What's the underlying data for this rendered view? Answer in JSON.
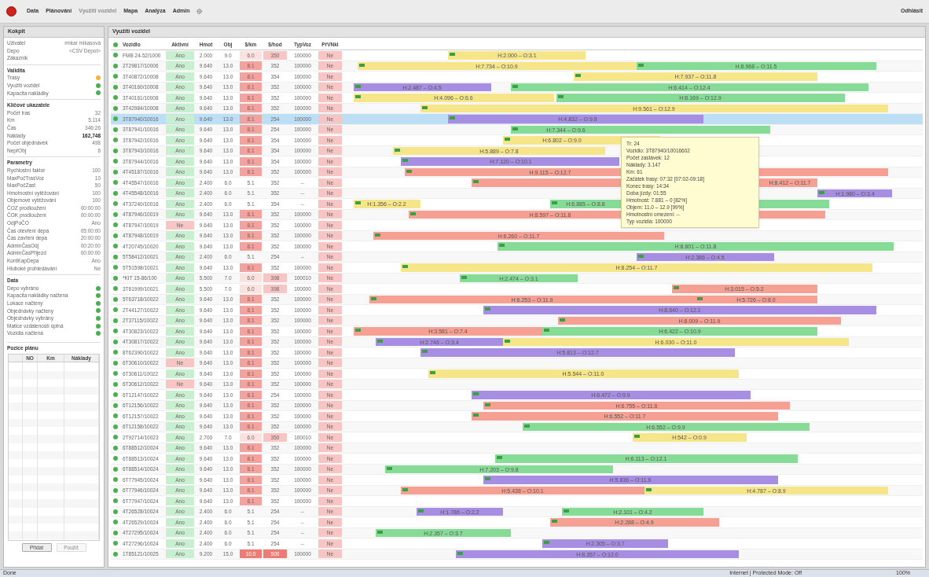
{
  "menu": {
    "items": [
      {
        "label": "Data",
        "disabled": false
      },
      {
        "label": "Plánování",
        "disabled": false
      },
      {
        "label": "Využití vozidel",
        "disabled": true
      },
      {
        "label": "Mapa",
        "disabled": false
      },
      {
        "label": "Analýza",
        "disabled": false
      },
      {
        "label": "Admin",
        "disabled": false
      }
    ],
    "logout": "Odhlásit"
  },
  "sidebar": {
    "title": "Kokpit",
    "info": [
      {
        "label": "Uživatel",
        "value": "rmkar mikasová"
      },
      {
        "label": "Depo",
        "value": "<CSV Depot>"
      },
      {
        "label": "Zákazník"
      }
    ],
    "sections": [
      {
        "title": "Validita",
        "rows": [
          {
            "kind": "status",
            "label": "Trasy",
            "color": "#f2b632"
          },
          {
            "kind": "status",
            "label": "Využití vozidel",
            "color": "#4caf50"
          },
          {
            "kind": "status",
            "label": "Kapacita nakládky",
            "color": "#4caf50"
          }
        ]
      },
      {
        "title": "Klíčové ukazatele",
        "rows": [
          {
            "kind": "value",
            "label": "Počet tras",
            "value": "32"
          },
          {
            "kind": "value",
            "label": "Km",
            "value": "5.114"
          },
          {
            "kind": "value",
            "label": "Čas",
            "value": "346:26"
          },
          {
            "kind": "bold",
            "label": "Náklady",
            "value": "162,748"
          },
          {
            "kind": "value",
            "label": "Počet objednávek",
            "value": "498"
          },
          {
            "kind": "value",
            "label": "NepřObj",
            "value": "6"
          }
        ]
      },
      {
        "title": "Parametry",
        "rows": [
          {
            "kind": "value",
            "label": "Rychlostní faktor",
            "value": "100"
          },
          {
            "kind": "value",
            "label": "MaxPočTrasVoz",
            "value": "10"
          },
          {
            "kind": "value",
            "label": "MaxPočZast",
            "value": "50"
          },
          {
            "kind": "value",
            "label": "Hmotnostní vytěžování",
            "value": "100"
          },
          {
            "kind": "value",
            "label": "Objemové vytěžování",
            "value": "100"
          },
          {
            "kind": "value",
            "label": "ČOZ prodloužení",
            "value": "00:00:00"
          },
          {
            "kind": "value",
            "label": "ČOK prodloužení",
            "value": "00:00:00"
          },
          {
            "kind": "value",
            "label": "OdjPoČO",
            "value": "Ano"
          },
          {
            "kind": "value",
            "label": "Čas otevření depa",
            "value": "05:00:00"
          },
          {
            "kind": "value",
            "label": "Čas zavření depa",
            "value": "20:00:00"
          },
          {
            "kind": "value",
            "label": "AdminČasOdj",
            "value": "00:20:00"
          },
          {
            "kind": "value",
            "label": "AdminČasPřijezd",
            "value": "00:00:00"
          },
          {
            "kind": "value",
            "label": "KontKapDepa",
            "value": "Ano"
          },
          {
            "kind": "value",
            "label": "Hluboké prohledávání",
            "value": "Ne"
          }
        ]
      },
      {
        "title": "Data",
        "rows": [
          {
            "kind": "status",
            "label": "Depo vybráno",
            "color": "#4caf50"
          },
          {
            "kind": "status",
            "label": "Kapacita nakládky načtena",
            "color": "#4caf50"
          },
          {
            "kind": "status",
            "label": "Lokace načteny",
            "color": "#4caf50"
          },
          {
            "kind": "status",
            "label": "Objednávky načteny",
            "color": "#4caf50"
          },
          {
            "kind": "status",
            "label": "Objednávky vybrány",
            "color": "#4caf50"
          },
          {
            "kind": "status",
            "label": "Matice vzdáleností úplná",
            "color": "#4caf50"
          },
          {
            "kind": "status",
            "label": "Vozidla načtena",
            "color": "#4caf50"
          }
        ]
      }
    ],
    "plan": {
      "title": "Pozice plánu",
      "columns": [
        "NO",
        "Km",
        "Náklady"
      ],
      "buttons": [
        {
          "label": "Přidat",
          "disabled": false
        },
        {
          "label": "Použít",
          "disabled": true
        }
      ]
    }
  },
  "panel_title": "Využití vozidel",
  "table": {
    "columns": [
      "Vozidlo",
      "Aktivní",
      "Hmot",
      "Obj",
      "$/km",
      "$/hod",
      "TypVoz",
      "PřVNkl"
    ],
    "rows": [
      {
        "selected": false,
        "cells": [
          {
            "text": "FMB 24-52/1000"
          },
          {
            "text": "Ano",
            "kind": "good"
          },
          {
            "text": "2.000"
          },
          {
            "text": "9.0"
          },
          {
            "text": "6.0",
            "kind": "light"
          },
          {
            "text": "350",
            "kind": "bad"
          },
          {
            "text": "100000"
          },
          {
            "text": "Ne",
            "kind": "bad"
          }
        ],
        "bars": [
          {
            "color": "#f7e58a",
            "label": "H:2.000 – O:3.1"
          }
        ]
      },
      {
        "selected": false,
        "cells": [
          {
            "text": "2T29817/10006"
          },
          {
            "text": "Ano",
            "kind": "good"
          },
          {
            "text": "9.640"
          },
          {
            "text": "13.0"
          },
          {
            "text": "8.1",
            "kind": "hot"
          },
          {
            "text": "352"
          },
          {
            "text": "100000"
          },
          {
            "text": "Ne",
            "kind": "bad"
          }
        ],
        "bars": [
          {
            "color": "#f7e58a",
            "label": "H:7.734 – O:10.9"
          },
          {
            "color": "#86dc96",
            "label": "H:8.968 – O:11.5"
          }
        ]
      },
      {
        "selected": false,
        "cells": [
          {
            "text": "3T40872/10008"
          },
          {
            "text": "Ano",
            "kind": "good"
          },
          {
            "text": "9.640"
          },
          {
            "text": "13.0"
          },
          {
            "text": "8.1",
            "kind": "hot"
          },
          {
            "text": "354"
          },
          {
            "text": "100000"
          },
          {
            "text": "Ne",
            "kind": "bad"
          }
        ],
        "bars": [
          {
            "color": "#f7e58a",
            "label": "H:7.937 – O:11.8"
          }
        ]
      },
      {
        "selected": false,
        "cells": [
          {
            "text": "3T40160/10008"
          },
          {
            "text": "Ano",
            "kind": "good"
          },
          {
            "text": "9.640"
          },
          {
            "text": "13.0"
          },
          {
            "text": "8.1",
            "kind": "hot"
          },
          {
            "text": "352"
          },
          {
            "text": "100000"
          },
          {
            "text": "Ne",
            "kind": "bad"
          }
        ],
        "bars": [
          {
            "color": "#a88ee3",
            "label": "H:2.487 – O:4.5"
          },
          {
            "color": "#86dc96",
            "label": "H:6.414 – O:12.4"
          }
        ]
      },
      {
        "selected": false,
        "cells": [
          {
            "text": "3T40161/10008"
          },
          {
            "text": "Ano",
            "kind": "good"
          },
          {
            "text": "9.640"
          },
          {
            "text": "13.0"
          },
          {
            "text": "8.1",
            "kind": "hot"
          },
          {
            "text": "352"
          },
          {
            "text": "100000"
          },
          {
            "text": "Ne",
            "kind": "bad"
          }
        ],
        "bars": [
          {
            "color": "#f7e58a",
            "label": "H:4.096 – O:6.6"
          },
          {
            "color": "#86dc96",
            "label": "H:8.169 – O:12.9"
          }
        ]
      },
      {
        "selected": false,
        "cells": [
          {
            "text": "3T42984/10008"
          },
          {
            "text": "Ano",
            "kind": "good"
          },
          {
            "text": "9.640"
          },
          {
            "text": "13.0"
          },
          {
            "text": "8.1",
            "kind": "hot"
          },
          {
            "text": "352"
          },
          {
            "text": "100000"
          },
          {
            "text": "Ne",
            "kind": "bad"
          }
        ],
        "bars": [
          {
            "color": "#f7e58a",
            "label": "H:9.561 – O:12.9"
          }
        ]
      },
      {
        "selected": true,
        "cells": [
          {
            "text": "3T87940/10016"
          },
          {
            "text": "Ano",
            "kind": "good"
          },
          {
            "text": "9.640"
          },
          {
            "text": "13.0"
          },
          {
            "text": "8.1",
            "kind": "hot"
          },
          {
            "text": "254"
          },
          {
            "text": "100000"
          },
          {
            "text": "Ne",
            "kind": "bad"
          }
        ],
        "bars": [
          {
            "color": "#a88ee3",
            "label": "H:4.832 – O:9.8"
          }
        ]
      },
      {
        "selected": false,
        "cells": [
          {
            "text": "3T87941/10016"
          },
          {
            "text": "Ano",
            "kind": "good"
          },
          {
            "text": "9.640"
          },
          {
            "text": "13.0"
          },
          {
            "text": "8.1",
            "kind": "hot"
          },
          {
            "text": "254"
          },
          {
            "text": "100000"
          },
          {
            "text": "Ne",
            "kind": "bad"
          }
        ],
        "bars": [
          {
            "color": "#86dc96",
            "label": "H:7.344 – O:9.6"
          }
        ]
      },
      {
        "selected": false,
        "cells": [
          {
            "text": "3T87942/10016"
          },
          {
            "text": "Ano",
            "kind": "good"
          },
          {
            "text": "9.640"
          },
          {
            "text": "13.0"
          },
          {
            "text": "8.1",
            "kind": "hot"
          },
          {
            "text": "354"
          },
          {
            "text": "100000"
          },
          {
            "text": "Ne",
            "kind": "bad"
          }
        ],
        "bars": [
          {
            "color": "#f7e58a",
            "label": "H:6.802 – O:9.0"
          }
        ]
      },
      {
        "selected": false,
        "cells": [
          {
            "text": "3T87943/10016"
          },
          {
            "text": "Ano",
            "kind": "good"
          },
          {
            "text": "9.640"
          },
          {
            "text": "13.0"
          },
          {
            "text": "8.1",
            "kind": "hot"
          },
          {
            "text": "354"
          },
          {
            "text": "100000"
          },
          {
            "text": "Ne",
            "kind": "bad"
          }
        ],
        "bars": [
          {
            "color": "#f7e58a",
            "label": "H:5.889 – O:7.8"
          }
        ]
      },
      {
        "selected": false,
        "cells": [
          {
            "text": "3T87944/10016"
          },
          {
            "text": "Ano",
            "kind": "good"
          },
          {
            "text": "9.640"
          },
          {
            "text": "13.0"
          },
          {
            "text": "8.1",
            "kind": "hot"
          },
          {
            "text": "354"
          },
          {
            "text": "100000"
          },
          {
            "text": "Ne",
            "kind": "bad"
          }
        ],
        "bars": [
          {
            "color": "#a88ee3",
            "label": "H:7.120 – O:10.1"
          }
        ]
      },
      {
        "selected": false,
        "cells": [
          {
            "text": "4T45187/10016"
          },
          {
            "text": "Ano",
            "kind": "good"
          },
          {
            "text": "9.640"
          },
          {
            "text": "13.0"
          },
          {
            "text": "8.1",
            "kind": "hot"
          },
          {
            "text": "352"
          },
          {
            "text": "100000"
          },
          {
            "text": "Ne",
            "kind": "bad"
          }
        ],
        "bars": [
          {
            "color": "#f5a093",
            "label": "H:9.115 – O:12.7"
          }
        ]
      },
      {
        "selected": false,
        "cells": [
          {
            "text": "4T45547/10016"
          },
          {
            "text": "Ano",
            "kind": "good"
          },
          {
            "text": "2.400"
          },
          {
            "text": "6.0"
          },
          {
            "text": "5.1"
          },
          {
            "text": "352"
          },
          {
            "text": "--"
          },
          {
            "text": "Ne",
            "kind": "bad"
          }
        ],
        "bars": [
          {
            "color": "#f5a093",
            "label": "H:8.412 – O:11.7"
          }
        ]
      },
      {
        "selected": false,
        "cells": [
          {
            "text": "4T45548/10016"
          },
          {
            "text": "Ano",
            "kind": "good"
          },
          {
            "text": "2.400"
          },
          {
            "text": "6.0"
          },
          {
            "text": "5.1"
          },
          {
            "text": "352"
          },
          {
            "text": "--"
          },
          {
            "text": "Ne",
            "kind": "bad"
          }
        ],
        "bars": [
          {
            "color": "#a88ee3",
            "label": "H:1.980 – O:3.4"
          }
        ]
      },
      {
        "selected": false,
        "cells": [
          {
            "text": "4T37240/10016"
          },
          {
            "text": "Ano",
            "kind": "good"
          },
          {
            "text": "2.400"
          },
          {
            "text": "6.0"
          },
          {
            "text": "5.1"
          },
          {
            "text": "354"
          },
          {
            "text": "--"
          },
          {
            "text": "Ne",
            "kind": "bad"
          }
        ],
        "bars": [
          {
            "color": "#f7e58a",
            "label": "H:1.356 – O:2.2"
          },
          {
            "color": "#86dc96",
            "label": "H:6.885 – O:8.8"
          }
        ]
      },
      {
        "selected": false,
        "cells": [
          {
            "text": "4T87946/10019"
          },
          {
            "text": "Ano",
            "kind": "good"
          },
          {
            "text": "9.640"
          },
          {
            "text": "13.0"
          },
          {
            "text": "8.1",
            "kind": "hot"
          },
          {
            "text": "352"
          },
          {
            "text": "100000"
          },
          {
            "text": "Ne",
            "kind": "bad"
          }
        ],
        "bars": [
          {
            "color": "#f5a093",
            "label": "H:8.597 – O:11.8"
          }
        ]
      },
      {
        "selected": false,
        "cells": [
          {
            "text": "4T87947/10019"
          },
          {
            "text": "Ne",
            "kind": "bad"
          },
          {
            "text": "9.640"
          },
          {
            "text": "13.0"
          },
          {
            "text": "8.1",
            "kind": "hot"
          },
          {
            "text": "352"
          },
          {
            "text": "100000"
          },
          {
            "text": "Ne",
            "kind": "bad"
          }
        ],
        "bars": []
      },
      {
        "selected": false,
        "cells": [
          {
            "text": "4T87948/10019"
          },
          {
            "text": "Ano",
            "kind": "good"
          },
          {
            "text": "9.640"
          },
          {
            "text": "13.0"
          },
          {
            "text": "8.1",
            "kind": "hot"
          },
          {
            "text": "352"
          },
          {
            "text": "100000"
          },
          {
            "text": "Ne",
            "kind": "bad"
          }
        ],
        "bars": [
          {
            "color": "#f5a093",
            "label": "H:6.260 – O:11.7"
          }
        ]
      },
      {
        "selected": false,
        "cells": [
          {
            "text": "4T20745/10020"
          },
          {
            "text": "Ano",
            "kind": "good"
          },
          {
            "text": "9.640"
          },
          {
            "text": "13.0"
          },
          {
            "text": "8.1",
            "kind": "hot"
          },
          {
            "text": "352"
          },
          {
            "text": "100000"
          },
          {
            "text": "Ne",
            "kind": "bad"
          }
        ],
        "bars": [
          {
            "color": "#86dc96",
            "label": "H:8.601 – O:11.8"
          }
        ]
      },
      {
        "selected": false,
        "cells": [
          {
            "text": "5T58412/10021"
          },
          {
            "text": "Ano",
            "kind": "good"
          },
          {
            "text": "2.400"
          },
          {
            "text": "6.0"
          },
          {
            "text": "5.1"
          },
          {
            "text": "254"
          },
          {
            "text": "--"
          },
          {
            "text": "Ne",
            "kind": "bad"
          }
        ],
        "bars": [
          {
            "color": "#a88ee3",
            "label": "H:2.386 – O:4.5"
          }
        ]
      },
      {
        "selected": false,
        "cells": [
          {
            "text": "5T51598/10021"
          },
          {
            "text": "Ano",
            "kind": "good"
          },
          {
            "text": "9.640"
          },
          {
            "text": "13.0"
          },
          {
            "text": "8.1",
            "kind": "hot"
          },
          {
            "text": "352"
          },
          {
            "text": "100000"
          },
          {
            "text": "Ne",
            "kind": "bad"
          }
        ],
        "bars": [
          {
            "color": "#f7e58a",
            "label": "H:8.254 – O:11.7"
          }
        ]
      },
      {
        "selected": false,
        "cells": [
          {
            "text": "*KIT 15-86/100"
          },
          {
            "text": "Ano",
            "kind": "good"
          },
          {
            "text": "5.500"
          },
          {
            "text": "7.0"
          },
          {
            "text": "6.0",
            "kind": "light"
          },
          {
            "text": "398",
            "kind": "bad"
          },
          {
            "text": "100010"
          },
          {
            "text": "Ne",
            "kind": "bad"
          }
        ],
        "bars": [
          {
            "color": "#86dc96",
            "label": "H:2.474 – O:3.1"
          }
        ]
      },
      {
        "selected": false,
        "cells": [
          {
            "text": "3T61999/10021"
          },
          {
            "text": "Ano",
            "kind": "good"
          },
          {
            "text": "5.500"
          },
          {
            "text": "7.0"
          },
          {
            "text": "6.0",
            "kind": "light"
          },
          {
            "text": "398",
            "kind": "bad"
          },
          {
            "text": "100000"
          },
          {
            "text": "Ne",
            "kind": "bad"
          }
        ],
        "bars": [
          {
            "color": "#f5a093",
            "label": "H:3.015 – O:5.2"
          }
        ]
      },
      {
        "selected": false,
        "cells": [
          {
            "text": "5T63718/10022"
          },
          {
            "text": "Ano",
            "kind": "good"
          },
          {
            "text": "9.640"
          },
          {
            "text": "13.0"
          },
          {
            "text": "8.1",
            "kind": "hot"
          },
          {
            "text": "352"
          },
          {
            "text": "100000"
          },
          {
            "text": "Ne",
            "kind": "bad"
          }
        ],
        "bars": [
          {
            "color": "#f5a093",
            "label": "H:6.253 – O:11.9"
          },
          {
            "color": "#f5a093",
            "label": "H:5.726 – O:8.0"
          }
        ]
      },
      {
        "selected": false,
        "cells": [
          {
            "text": "2T44127/10022"
          },
          {
            "text": "Ano",
            "kind": "good"
          },
          {
            "text": "9.640"
          },
          {
            "text": "13.0"
          },
          {
            "text": "8.1",
            "kind": "hot"
          },
          {
            "text": "352"
          },
          {
            "text": "100000"
          },
          {
            "text": "Ne",
            "kind": "bad"
          }
        ],
        "bars": [
          {
            "color": "#a88ee3",
            "label": "H:8.640 – O:12.1"
          }
        ]
      },
      {
        "selected": false,
        "cells": [
          {
            "text": "2T37115/10022"
          },
          {
            "text": "Ano",
            "kind": "good"
          },
          {
            "text": "9.640"
          },
          {
            "text": "13.0"
          },
          {
            "text": "8.1",
            "kind": "hot"
          },
          {
            "text": "352"
          },
          {
            "text": "100000"
          },
          {
            "text": "Ne",
            "kind": "bad"
          }
        ],
        "bars": [
          {
            "color": "#f5a093",
            "label": "H:8.009 – O:11.9"
          }
        ]
      },
      {
        "selected": false,
        "cells": [
          {
            "text": "4T30823/10022"
          },
          {
            "text": "Ano",
            "kind": "good"
          },
          {
            "text": "9.640"
          },
          {
            "text": "13.0"
          },
          {
            "text": "8.1",
            "kind": "hot"
          },
          {
            "text": "352"
          },
          {
            "text": "100000"
          },
          {
            "text": "Ne",
            "kind": "bad"
          }
        ],
        "bars": [
          {
            "color": "#f5a093",
            "label": "H:3.581 – O:7.4"
          },
          {
            "color": "#86dc96",
            "label": "H:6.422 – O:10.9"
          }
        ]
      },
      {
        "selected": false,
        "cells": [
          {
            "text": "4T30817/10022"
          },
          {
            "text": "Ano",
            "kind": "good"
          },
          {
            "text": "9.640"
          },
          {
            "text": "13.0"
          },
          {
            "text": "8.1",
            "kind": "hot"
          },
          {
            "text": "352"
          },
          {
            "text": "100000"
          },
          {
            "text": "Ne",
            "kind": "bad"
          }
        ],
        "bars": [
          {
            "color": "#a88ee3",
            "label": "H:2.746 – O:3.4"
          },
          {
            "color": "#f7e58a",
            "label": "H:6.030 – O:11.0"
          }
        ]
      },
      {
        "selected": false,
        "cells": [
          {
            "text": "8T62390/10022"
          },
          {
            "text": "Ano",
            "kind": "good"
          },
          {
            "text": "9.640"
          },
          {
            "text": "13.0"
          },
          {
            "text": "8.1",
            "kind": "hot"
          },
          {
            "text": "352"
          },
          {
            "text": "100000"
          },
          {
            "text": "Ne",
            "kind": "bad"
          }
        ],
        "bars": [
          {
            "color": "#a88ee3",
            "label": "H:5.813 – O:12.7"
          }
        ]
      },
      {
        "selected": false,
        "cells": [
          {
            "text": "6T30610/10022"
          },
          {
            "text": "Ne",
            "kind": "bad"
          },
          {
            "text": "9.640"
          },
          {
            "text": "13.0"
          },
          {
            "text": "8.1",
            "kind": "hot"
          },
          {
            "text": "352"
          },
          {
            "text": "100000"
          },
          {
            "text": "Ne",
            "kind": "bad"
          }
        ],
        "bars": []
      },
      {
        "selected": false,
        "cells": [
          {
            "text": "6T30611/10022"
          },
          {
            "text": "Ano",
            "kind": "good"
          },
          {
            "text": "9.640"
          },
          {
            "text": "13.0"
          },
          {
            "text": "8.1",
            "kind": "hot"
          },
          {
            "text": "352"
          },
          {
            "text": "100000"
          },
          {
            "text": "Ne",
            "kind": "bad"
          }
        ],
        "bars": [
          {
            "color": "#f7e58a",
            "label": "H:5.544 – O:11.0"
          }
        ]
      },
      {
        "selected": false,
        "cells": [
          {
            "text": "6T30612/10022"
          },
          {
            "text": "Ne",
            "kind": "bad"
          },
          {
            "text": "9.640"
          },
          {
            "text": "13.0"
          },
          {
            "text": "8.1",
            "kind": "hot"
          },
          {
            "text": "352"
          },
          {
            "text": "100000"
          },
          {
            "text": "Ne",
            "kind": "bad"
          }
        ],
        "bars": []
      },
      {
        "selected": false,
        "cells": [
          {
            "text": "6T12147/10022"
          },
          {
            "text": "Ano",
            "kind": "good"
          },
          {
            "text": "9.640"
          },
          {
            "text": "13.0"
          },
          {
            "text": "8.1",
            "kind": "hot"
          },
          {
            "text": "254"
          },
          {
            "text": "100000"
          },
          {
            "text": "Ne",
            "kind": "bad"
          }
        ],
        "bars": [
          {
            "color": "#a88ee3",
            "label": "H:6.472 – O:9.9"
          }
        ]
      },
      {
        "selected": false,
        "cells": [
          {
            "text": "6T12156/10022"
          },
          {
            "text": "Ano",
            "kind": "good"
          },
          {
            "text": "9.640"
          },
          {
            "text": "13.0"
          },
          {
            "text": "8.1",
            "kind": "hot"
          },
          {
            "text": "352"
          },
          {
            "text": "100000"
          },
          {
            "text": "Ne",
            "kind": "bad"
          }
        ],
        "bars": [
          {
            "color": "#f5a093",
            "label": "H:6.755 – O:11.6"
          }
        ]
      },
      {
        "selected": false,
        "cells": [
          {
            "text": "6T12157/10022"
          },
          {
            "text": "Ano",
            "kind": "good"
          },
          {
            "text": "9.640"
          },
          {
            "text": "13.0"
          },
          {
            "text": "8.1",
            "kind": "hot"
          },
          {
            "text": "352"
          },
          {
            "text": "100000"
          },
          {
            "text": "Ne",
            "kind": "bad"
          }
        ],
        "bars": [
          {
            "color": "#f5a093",
            "label": "H:6.552 – O:11.7"
          }
        ]
      },
      {
        "selected": false,
        "cells": [
          {
            "text": "6T12158/10022"
          },
          {
            "text": "Ano",
            "kind": "good"
          },
          {
            "text": "9.640"
          },
          {
            "text": "13.0"
          },
          {
            "text": "8.1",
            "kind": "hot"
          },
          {
            "text": "352"
          },
          {
            "text": "100000"
          },
          {
            "text": "Ne",
            "kind": "bad"
          }
        ],
        "bars": [
          {
            "color": "#86dc96",
            "label": "H:6.552 – O:9.9"
          }
        ]
      },
      {
        "selected": false,
        "cells": [
          {
            "text": "2T92714/10023"
          },
          {
            "text": "Ano",
            "kind": "good"
          },
          {
            "text": "2.700"
          },
          {
            "text": "7.0"
          },
          {
            "text": "6.0",
            "kind": "light"
          },
          {
            "text": "350",
            "kind": "bad"
          },
          {
            "text": "100010"
          },
          {
            "text": "Ne",
            "kind": "bad"
          }
        ],
        "bars": [
          {
            "color": "#f7e58a",
            "label": "H:542 – O:0.9"
          }
        ]
      },
      {
        "selected": false,
        "cells": [
          {
            "text": "6T88512/10024"
          },
          {
            "text": "Ano",
            "kind": "good"
          },
          {
            "text": "9.640"
          },
          {
            "text": "13.0"
          },
          {
            "text": "8.1",
            "kind": "hot"
          },
          {
            "text": "352"
          },
          {
            "text": "100000"
          },
          {
            "text": "Ne",
            "kind": "bad"
          }
        ],
        "bars": []
      },
      {
        "selected": false,
        "cells": [
          {
            "text": "6T88513/10024"
          },
          {
            "text": "Ano",
            "kind": "good"
          },
          {
            "text": "9.640"
          },
          {
            "text": "13.0"
          },
          {
            "text": "8.1",
            "kind": "hot"
          },
          {
            "text": "352"
          },
          {
            "text": "100000"
          },
          {
            "text": "Ne",
            "kind": "bad"
          }
        ],
        "bars": [
          {
            "color": "#86dc96",
            "label": "H:6.113 – O:12.1"
          }
        ]
      },
      {
        "selected": false,
        "cells": [
          {
            "text": "6T88514/10024"
          },
          {
            "text": "Ano",
            "kind": "good"
          },
          {
            "text": "9.640"
          },
          {
            "text": "13.0"
          },
          {
            "text": "8.1",
            "kind": "hot"
          },
          {
            "text": "352"
          },
          {
            "text": "100000"
          },
          {
            "text": "Ne",
            "kind": "bad"
          }
        ],
        "bars": [
          {
            "color": "#86dc96",
            "label": "H:7.203 – O:9.8"
          }
        ]
      },
      {
        "selected": false,
        "cells": [
          {
            "text": "6T77945/10024"
          },
          {
            "text": "Ano",
            "kind": "good"
          },
          {
            "text": "9.640"
          },
          {
            "text": "13.0"
          },
          {
            "text": "8.1",
            "kind": "hot"
          },
          {
            "text": "352"
          },
          {
            "text": "100000"
          },
          {
            "text": "Ne",
            "kind": "bad"
          }
        ],
        "bars": [
          {
            "color": "#a88ee3",
            "label": "H:5.836 – O:11.8"
          }
        ]
      },
      {
        "selected": false,
        "cells": [
          {
            "text": "6T77946/10024"
          },
          {
            "text": "Ano",
            "kind": "good"
          },
          {
            "text": "9.640"
          },
          {
            "text": "13.0"
          },
          {
            "text": "8.1",
            "kind": "hot"
          },
          {
            "text": "352"
          },
          {
            "text": "100000"
          },
          {
            "text": "Ne",
            "kind": "bad"
          }
        ],
        "bars": [
          {
            "color": "#f5a093",
            "label": "H:5.438 – O:10.1"
          },
          {
            "color": "#f7e58a",
            "label": "H:4.787 – O:8.9"
          }
        ]
      },
      {
        "selected": false,
        "cells": [
          {
            "text": "6T77947/10024"
          },
          {
            "text": "Ano",
            "kind": "good"
          },
          {
            "text": "9.640"
          },
          {
            "text": "13.0"
          },
          {
            "text": "8.1",
            "kind": "hot"
          },
          {
            "text": "352"
          },
          {
            "text": "100000"
          },
          {
            "text": "Ne",
            "kind": "bad"
          }
        ],
        "bars": []
      },
      {
        "selected": false,
        "cells": [
          {
            "text": "4T26528/10024"
          },
          {
            "text": "Ano",
            "kind": "good"
          },
          {
            "text": "2.400"
          },
          {
            "text": "6.0"
          },
          {
            "text": "5.1"
          },
          {
            "text": "254"
          },
          {
            "text": "--"
          },
          {
            "text": "Ne",
            "kind": "bad"
          }
        ],
        "bars": [
          {
            "color": "#a88ee3",
            "label": "H:1.786 – O:2.2"
          },
          {
            "color": "#86dc96",
            "label": "H:2.101 – O:4.2"
          }
        ]
      },
      {
        "selected": false,
        "cells": [
          {
            "text": "4T26529/10024"
          },
          {
            "text": "Ano",
            "kind": "good"
          },
          {
            "text": "2.400"
          },
          {
            "text": "6.0"
          },
          {
            "text": "5.1"
          },
          {
            "text": "254"
          },
          {
            "text": "--"
          },
          {
            "text": "Ne",
            "kind": "bad"
          }
        ],
        "bars": [
          {
            "color": "#f5a093",
            "label": "H:2.288 – O:4.9"
          }
        ]
      },
      {
        "selected": false,
        "cells": [
          {
            "text": "4T27295/10024"
          },
          {
            "text": "Ano",
            "kind": "good"
          },
          {
            "text": "2.400"
          },
          {
            "text": "6.0"
          },
          {
            "text": "5.1"
          },
          {
            "text": "254"
          },
          {
            "text": "--"
          },
          {
            "text": "Ne",
            "kind": "bad"
          }
        ],
        "bars": [
          {
            "color": "#86dc96",
            "label": "H:2.357 – O:3.7"
          }
        ]
      },
      {
        "selected": false,
        "cells": [
          {
            "text": "4T27296/10024"
          },
          {
            "text": "Ano",
            "kind": "good"
          },
          {
            "text": "2.400"
          },
          {
            "text": "6.0"
          },
          {
            "text": "5.1"
          },
          {
            "text": "254"
          },
          {
            "text": "--"
          },
          {
            "text": "Ne",
            "kind": "bad"
          }
        ],
        "bars": [
          {
            "color": "#a88ee3",
            "label": "H:2.305 – O:3.7"
          }
        ]
      },
      {
        "selected": false,
        "cells": [
          {
            "text": "1T85121/10025"
          },
          {
            "text": "Ano",
            "kind": "good"
          },
          {
            "text": "9.200"
          },
          {
            "text": "15.0"
          },
          {
            "text": "10.0",
            "kind": "max"
          },
          {
            "text": "500",
            "kind": "max"
          },
          {
            "text": "100000"
          },
          {
            "text": "Ne",
            "kind": "bad"
          }
        ],
        "bars": [
          {
            "color": "#a88ee3",
            "label": "H:8.357 – O:12.0"
          }
        ]
      }
    ]
  },
  "tooltip": {
    "lines": [
      "Tr: 24",
      "Vozidlo: 3T87940/10016602",
      "Počet zastávek: 12",
      "Náklady: 3.147",
      "Km: 61",
      "Začátek trasy: 07:32 [07:02-09:18]",
      "Konec trasy: 14:34",
      "Doba jízdy: 01:55",
      "Hmotnost: 7.881 – 0 [82%]",
      "Objem: 11.0 – 12.9 [99%]",
      "Hmotnostní omezení: --",
      "Typ vozidla: 100000"
    ]
  },
  "status_bar": {
    "text": "Done",
    "zone": "Internet | Protected Mode: Off",
    "zoom": "100%"
  }
}
